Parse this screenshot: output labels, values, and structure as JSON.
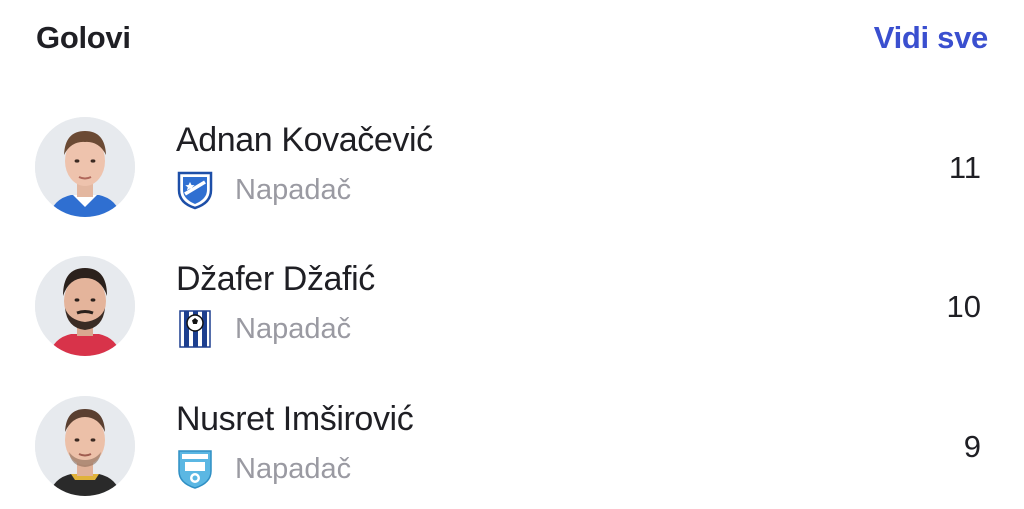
{
  "header": {
    "title": "Golovi",
    "see_all_label": "Vidi sve"
  },
  "players": [
    {
      "name": "Adnan Kovačević",
      "position": "Napadač",
      "goals": "11",
      "jersey_color": "#2f6fd1",
      "club_crest": "blue-shield-crest-icon"
    },
    {
      "name": "Džafer Džafić",
      "position": "Napadač",
      "goals": "10",
      "jersey_color": "#d8334a",
      "club_crest": "blue-striped-ball-crest-icon"
    },
    {
      "name": "Nusret Imširović",
      "position": "Napadač",
      "goals": "9",
      "jersey_color": "#2a2a2a",
      "club_crest": "light-blue-shield-crest-icon"
    }
  ],
  "colors": {
    "accent": "#3a4fcf",
    "text": "#1f1f24",
    "secondary_text": "#9a9aa2"
  }
}
